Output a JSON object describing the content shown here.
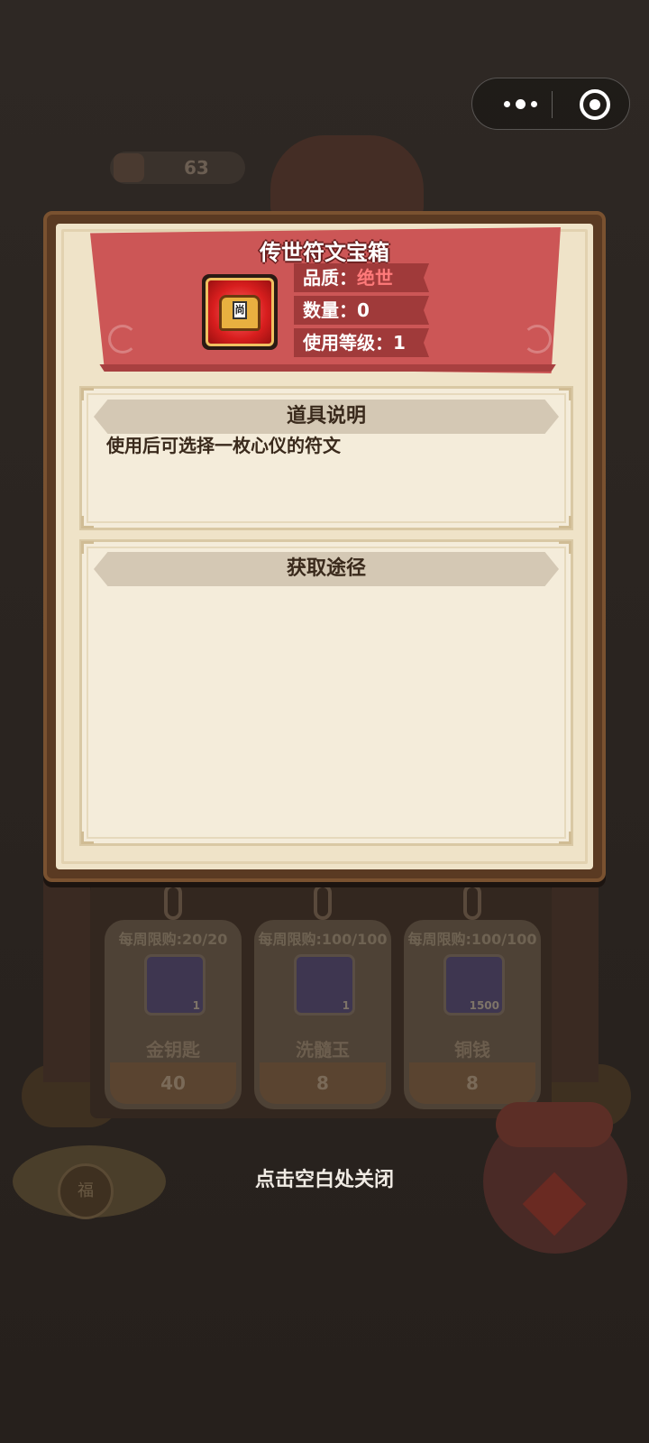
{
  "capsule": {
    "more_icon": "more-dots-icon",
    "close_icon": "target-circle-icon"
  },
  "background": {
    "currency_value": "63",
    "shop_cards": [
      {
        "limit": "每周限购:20/20",
        "name": "金钥匙",
        "count": "1",
        "price": "40",
        "icon": "gold-key-icon"
      },
      {
        "limit": "每周限购:100/100",
        "name": "洗髓玉",
        "count": "1",
        "price": "8",
        "icon": "jade-icon"
      },
      {
        "limit": "每周限购:100/100",
        "name": "铜钱",
        "count": "1500",
        "price": "8",
        "icon": "copper-coin-icon"
      }
    ],
    "coin_glyph": "福"
  },
  "item": {
    "title": "传世符文宝箱",
    "icon": "rune-treasure-chest-icon",
    "quality_label": "品质：",
    "quality_value": "绝世",
    "quantity": "数量：0",
    "use_level": "使用等级：1",
    "quality_color": "#ff7a7a"
  },
  "description": {
    "header": "道具说明",
    "text": "使用后可选择一枚心仪的符文"
  },
  "acquire": {
    "header": "获取途径"
  },
  "close_hint": "点击空白处关闭"
}
